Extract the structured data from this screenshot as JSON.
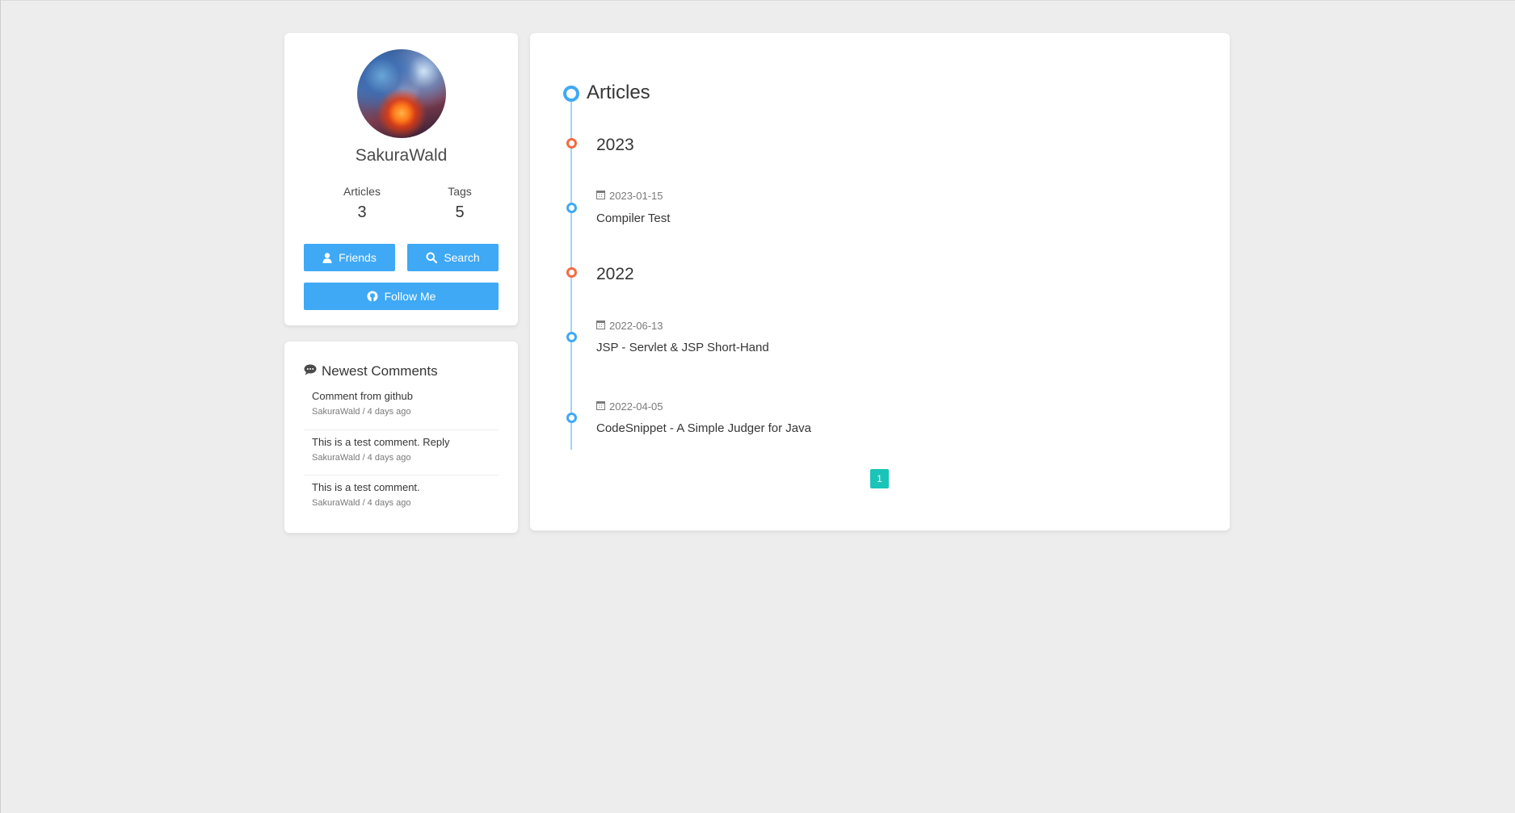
{
  "profile": {
    "name": "SakuraWald",
    "stats": [
      {
        "label": "Articles",
        "value": "3"
      },
      {
        "label": "Tags",
        "value": "5"
      }
    ],
    "buttons": {
      "friends": "Friends",
      "search": "Search",
      "follow": "Follow Me"
    }
  },
  "comments": {
    "title": "Newest Comments",
    "items": [
      {
        "text": "Comment from github",
        "meta": "SakuraWald / 4 days ago"
      },
      {
        "text": "This is a test comment. Reply",
        "meta": "SakuraWald / 4 days ago"
      },
      {
        "text": "This is a test comment.",
        "meta": "SakuraWald / 4 days ago"
      }
    ]
  },
  "archive": {
    "heading": "Articles",
    "years": [
      {
        "year": "2023",
        "posts": [
          {
            "date": "2023-01-15",
            "title": "Compiler Test"
          }
        ]
      },
      {
        "year": "2022",
        "posts": [
          {
            "date": "2022-06-13",
            "title": "JSP - Servlet & JSP Short-Hand"
          },
          {
            "date": "2022-04-05",
            "title": "CodeSnippet - A Simple Judger for Java"
          }
        ]
      }
    ],
    "pagination": {
      "current_page": "1"
    }
  },
  "icons": {
    "avatar": "avatar-image",
    "friends": "user-icon",
    "search": "search-icon",
    "follow": "github-icon",
    "comments": "comment-icon",
    "date": "calendar-icon"
  },
  "colors": {
    "background": "#ededed",
    "accent_blue": "#3fa9f5",
    "year_orange": "#f26b44",
    "pagination_teal": "#1bc4b8"
  }
}
